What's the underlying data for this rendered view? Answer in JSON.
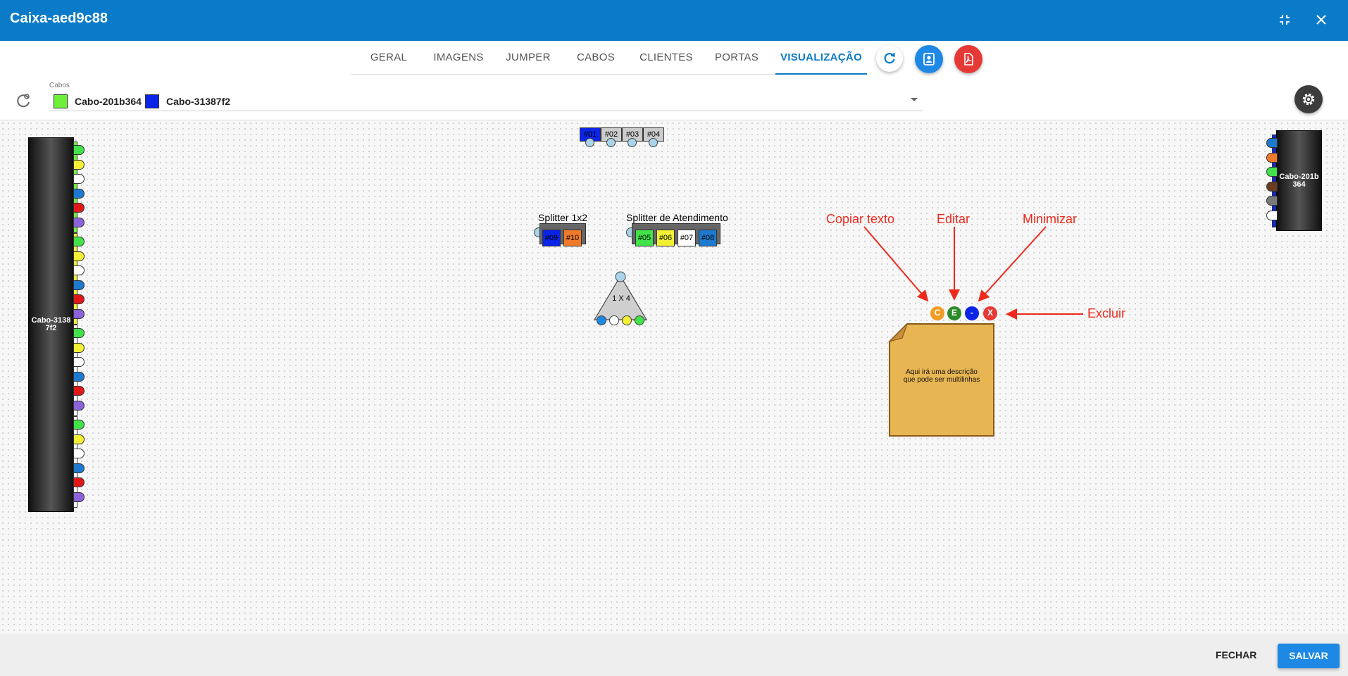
{
  "window": {
    "title": "Caixa-aed9c88"
  },
  "tabs": [
    {
      "label": "GERAL"
    },
    {
      "label": "IMAGENS"
    },
    {
      "label": "JUMPER"
    },
    {
      "label": "CABOS"
    },
    {
      "label": "CLIENTES"
    },
    {
      "label": "PORTAS"
    },
    {
      "label": "VISUALIZAÇÃO",
      "active": true
    }
  ],
  "cabos": {
    "label": "Cabos",
    "chips": [
      {
        "name": "Cabo-201b364",
        "color": "#6ef03a"
      },
      {
        "name": "Cabo-31387f2",
        "color": "#0b24e8"
      }
    ]
  },
  "canvas": {
    "left_cable": {
      "label": "Cabo-3138\n7f2"
    },
    "right_cable": {
      "label": "Cabo-201b\n364"
    },
    "top_ports": [
      "#01",
      "#02",
      "#03",
      "#04"
    ],
    "splitter1": {
      "title": "Splitter 1x2",
      "ports": [
        "#09",
        "#10"
      ]
    },
    "splitter2": {
      "title": "Splitter de Atendimento",
      "ports": [
        "#05",
        "#06",
        "#07",
        "#08"
      ]
    },
    "triangle": {
      "label": "1 X 4"
    },
    "note": {
      "text": "Aqui irá uma descrição que pode ser multilinhas",
      "buttons": [
        "C",
        "E",
        "-",
        "X"
      ]
    },
    "annotations": {
      "copy": "Copiar texto",
      "edit": "Editar",
      "minimize": "Minimizar",
      "delete": "Excluir"
    }
  },
  "footer": {
    "close_label": "FECHAR",
    "save_label": "SALVAR"
  },
  "colors": {
    "header": "#0a7bc8",
    "accent": "#0a7bc8",
    "pdf_button": "#e53935",
    "annotation": "#ee2a1c",
    "note": "#e8b553"
  }
}
